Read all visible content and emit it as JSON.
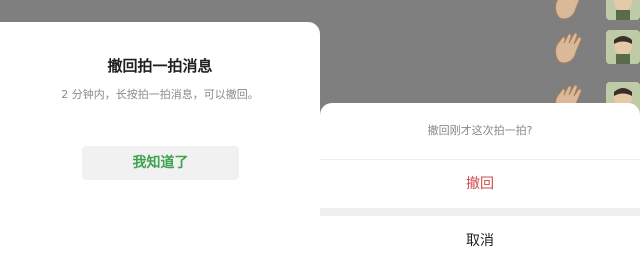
{
  "left_dialog": {
    "title": "撤回拍一拍消息",
    "description": "2 分钟内，长按拍一拍消息，可以撤回。",
    "confirm_label": "我知道了"
  },
  "action_sheet": {
    "prompt": "撤回刚才这次拍一拍?",
    "withdraw_label": "撤回",
    "cancel_label": "取消"
  },
  "chat_rows": [
    {
      "icon": "clapping-hand-icon"
    },
    {
      "icon": "clapping-hand-icon"
    },
    {
      "icon": "clapping-hand-icon"
    }
  ],
  "colors": {
    "overlay": "#7f7f7f",
    "confirm_text": "#3fa24e",
    "destructive_text": "#d04b4b"
  }
}
